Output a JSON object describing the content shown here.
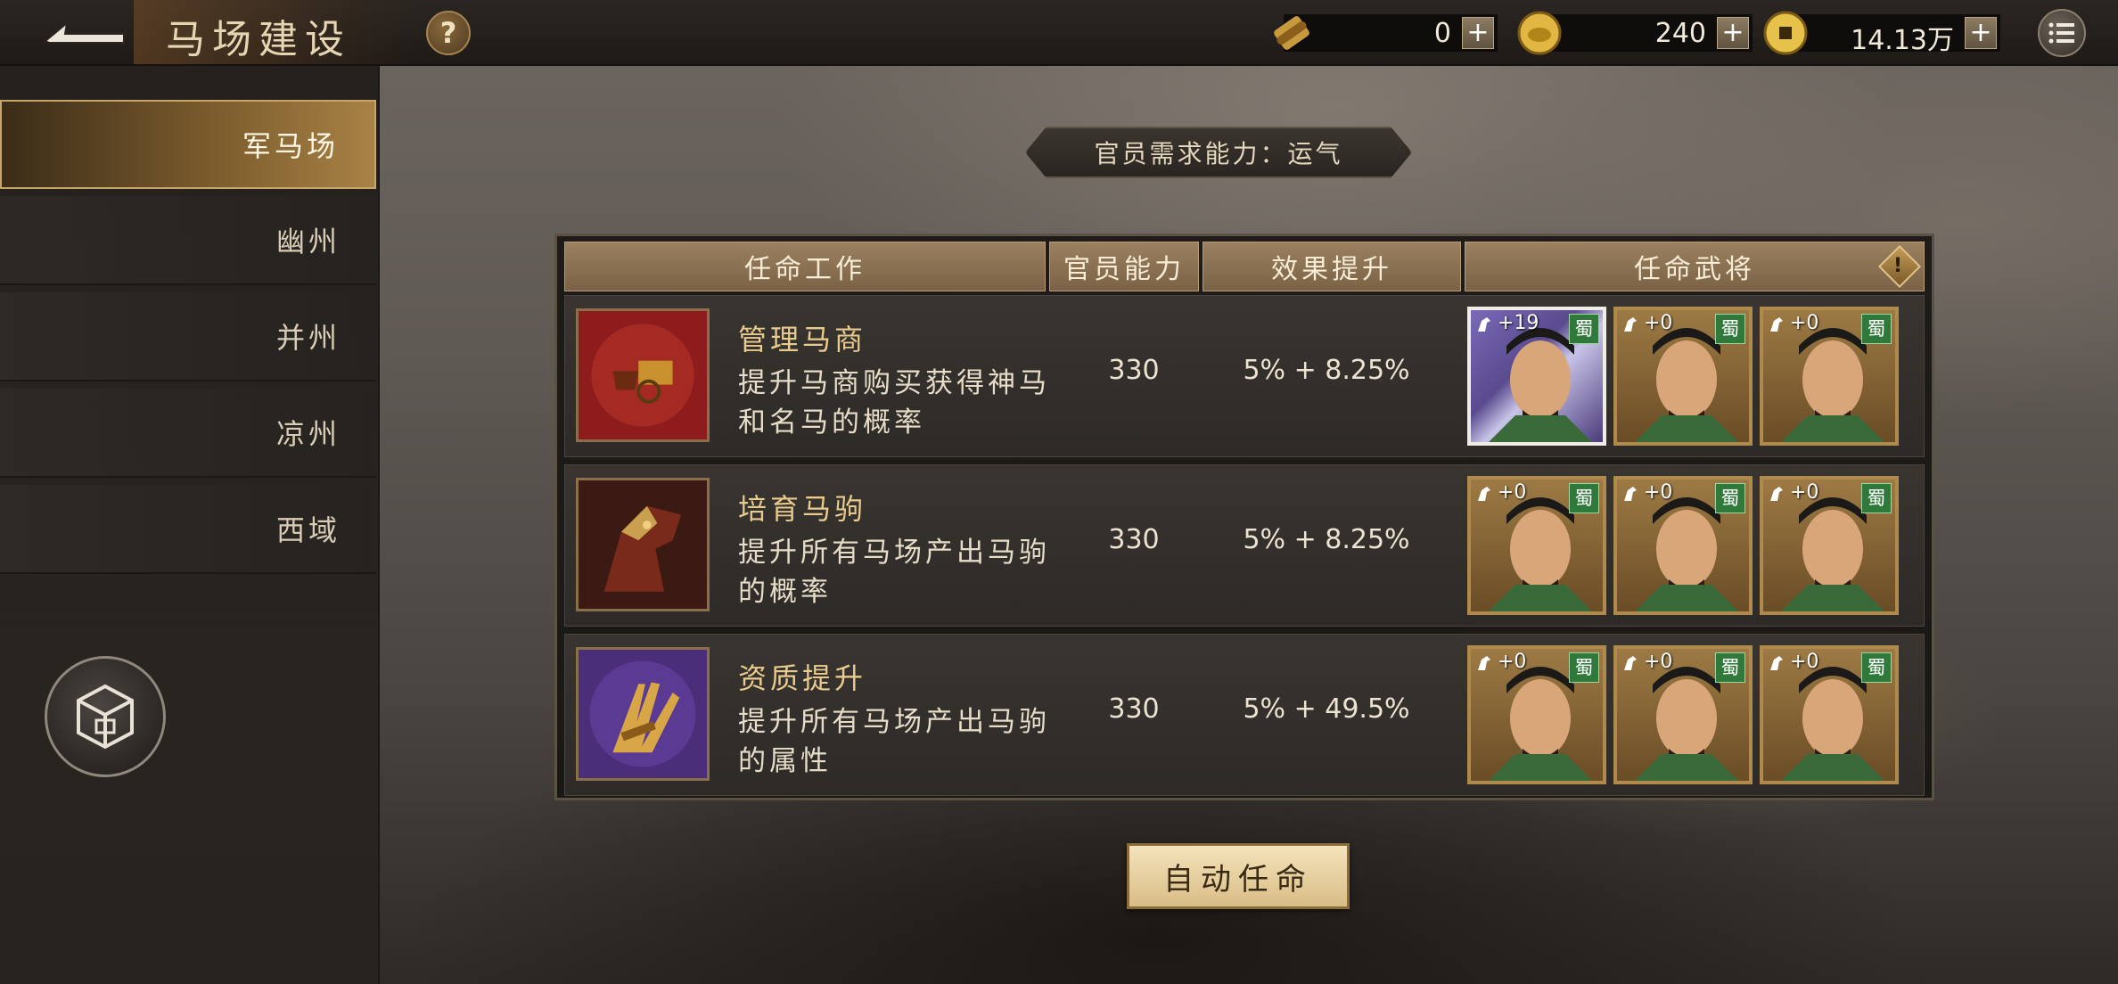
{
  "header": {
    "title": "马场建设",
    "help_label": "?",
    "resources": [
      {
        "icon": "scroll-icon",
        "value": "0"
      },
      {
        "icon": "gold-ingot-icon",
        "value": "240"
      },
      {
        "icon": "copper-coin-icon",
        "value": "14.13万"
      }
    ],
    "plus_label": "+"
  },
  "sidebar": {
    "items": [
      {
        "label": "军马场",
        "active": true
      },
      {
        "label": "幽州",
        "active": false
      },
      {
        "label": "并州",
        "active": false
      },
      {
        "label": "凉州",
        "active": false
      },
      {
        "label": "西域",
        "active": false
      }
    ]
  },
  "requirement": "官员需求能力：运气",
  "table": {
    "headers": [
      "任命工作",
      "官员能力",
      "效果提升",
      "任命武将"
    ],
    "info_label": "!",
    "rows": [
      {
        "icon": "horse-carriage-icon",
        "name": "管理马商",
        "desc": "提升马商购买获得神马和名马的概率",
        "ability": "330",
        "effect": "5% + 8.25%",
        "generals": [
          {
            "bonus": "+19",
            "faction": "蜀"
          },
          {
            "bonus": "+0",
            "faction": "蜀"
          },
          {
            "bonus": "+0",
            "faction": "蜀"
          }
        ]
      },
      {
        "icon": "war-horse-icon",
        "name": "培育马驹",
        "desc": "提升所有马场产出马驹的概率",
        "ability": "330",
        "effect": "5% + 8.25%",
        "generals": [
          {
            "bonus": "+0",
            "faction": "蜀"
          },
          {
            "bonus": "+0",
            "faction": "蜀"
          },
          {
            "bonus": "+0",
            "faction": "蜀"
          }
        ]
      },
      {
        "icon": "hay-bundle-icon",
        "name": "资质提升",
        "desc": "提升所有马场产出马驹的属性",
        "ability": "330",
        "effect": "5% + 49.5%",
        "generals": [
          {
            "bonus": "+0",
            "faction": "蜀"
          },
          {
            "bonus": "+0",
            "faction": "蜀"
          },
          {
            "bonus": "+0",
            "faction": "蜀"
          }
        ]
      }
    ]
  },
  "auto_button": "自动任命",
  "colors": {
    "accent": "#a88245",
    "faction": "#2f7a3a",
    "header": "#8b7052"
  }
}
